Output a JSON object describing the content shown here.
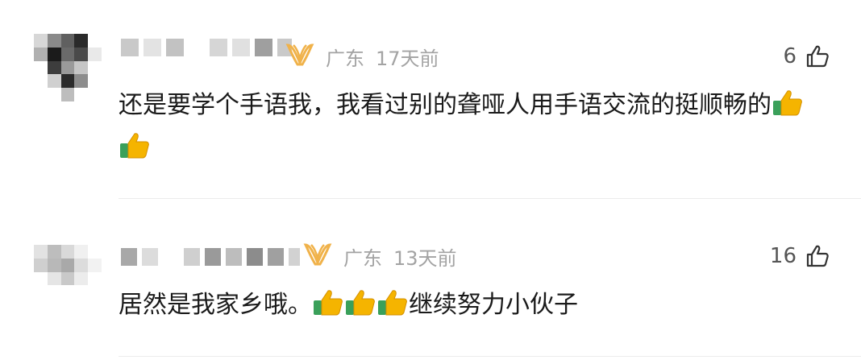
{
  "comments": [
    {
      "location": "广东",
      "time": "17天前",
      "likes": "6",
      "text": "还是要学个手语我，我看过别的聋哑人用手语交流的挺顺畅的",
      "emoji_count": 2,
      "emoji_icon": "thumbs-up-emoji"
    },
    {
      "location": "广东",
      "time": "13天前",
      "likes": "16",
      "text_before": "居然是我家乡哦。",
      "text_after": "继续努力小伙子",
      "emoji_count": 3,
      "emoji_icon": "thumbs-up-emoji"
    }
  ],
  "colors": {
    "medal": "#f0b24a",
    "meta": "#a3a3a3",
    "thumb_emoji": "#f5b400",
    "thumb_cuff": "#3aa05a"
  }
}
